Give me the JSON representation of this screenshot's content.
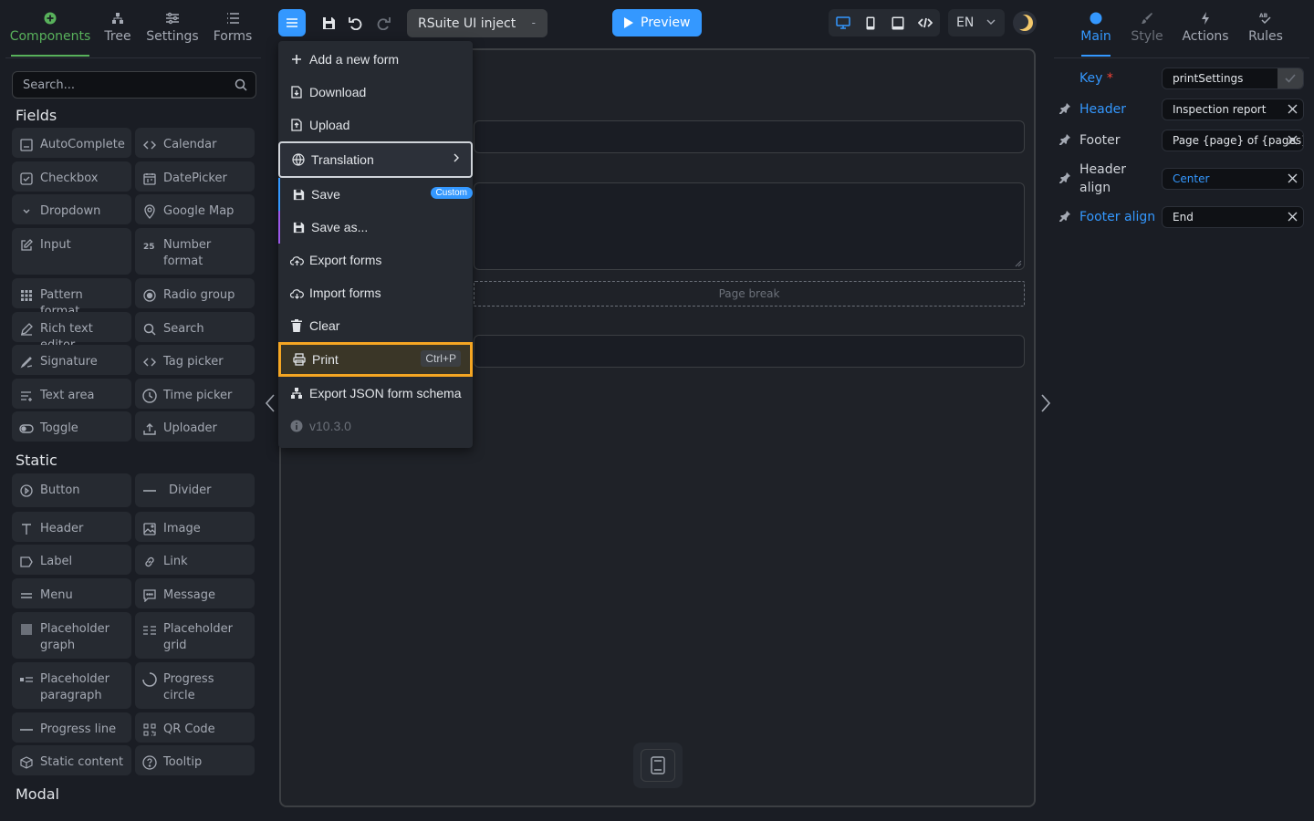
{
  "left_tabs": [
    {
      "label": "Components",
      "icon": "plus-circle-icon",
      "active": true
    },
    {
      "label": "Tree",
      "icon": "tree-icon"
    },
    {
      "label": "Settings",
      "icon": "sliders-icon"
    },
    {
      "label": "Forms",
      "icon": "list-icon"
    }
  ],
  "search": {
    "placeholder": "Search..."
  },
  "sections": {
    "fields": "Fields",
    "static": "Static",
    "modal": "Modal"
  },
  "fields": [
    {
      "label": "AutoComplete",
      "icon": "autocomplete-icon"
    },
    {
      "label": "Calendar",
      "icon": "code-brackets-icon"
    },
    {
      "label": "Checkbox",
      "icon": "checkbox-icon"
    },
    {
      "label": "DatePicker",
      "icon": "calendar-icon"
    },
    {
      "label": "Dropdown",
      "icon": "chevron-down-icon"
    },
    {
      "label": "Google Map",
      "icon": "map-pin-icon"
    },
    {
      "label": "Input",
      "icon": "edit-icon"
    },
    {
      "label": "Number format",
      "icon": "number-icon"
    },
    {
      "label": "Pattern format",
      "icon": "grid-dots-icon"
    },
    {
      "label": "Radio group",
      "icon": "radio-icon"
    },
    {
      "label": "Rich text editor",
      "icon": "pen-icon"
    },
    {
      "label": "Search",
      "icon": "search-icon"
    },
    {
      "label": "Signature",
      "icon": "signature-icon"
    },
    {
      "label": "Tag picker",
      "icon": "code-brackets-icon"
    },
    {
      "label": "Text area",
      "icon": "text-area-icon"
    },
    {
      "label": "Time picker",
      "icon": "clock-icon"
    },
    {
      "label": "Toggle",
      "icon": "toggle-icon"
    },
    {
      "label": "Uploader",
      "icon": "upload-icon"
    }
  ],
  "statics": [
    {
      "label": "Button",
      "icon": "button-icon"
    },
    {
      "label": "Divider",
      "icon": "divider-icon"
    },
    {
      "label": "Header",
      "icon": "text-t-icon"
    },
    {
      "label": "Image",
      "icon": "image-icon"
    },
    {
      "label": "Label",
      "icon": "label-icon"
    },
    {
      "label": "Link",
      "icon": "link-icon"
    },
    {
      "label": "Menu",
      "icon": "menu-icon"
    },
    {
      "label": "Message",
      "icon": "message-icon"
    },
    {
      "label": "Placeholder graph",
      "icon": "square-icon"
    },
    {
      "label": "Placeholder grid",
      "icon": "grid-lines-icon"
    },
    {
      "label": "Placeholder paragraph",
      "icon": "paragraph-icon"
    },
    {
      "label": "Progress circle",
      "icon": "progress-circle-icon"
    },
    {
      "label": "Progress line",
      "icon": "progress-line-icon"
    },
    {
      "label": "QR Code",
      "icon": "qr-code-icon"
    },
    {
      "label": "Static content",
      "icon": "cube-icon"
    },
    {
      "label": "Tooltip",
      "icon": "help-circle-icon"
    }
  ],
  "toolbar": {
    "project_name": "RSuite UI inject",
    "project_caret": "-",
    "preview_label": "Preview",
    "language": "EN"
  },
  "canvas": {
    "page_break_label": "Page break"
  },
  "menu": {
    "add_form": "Add a new form",
    "download": "Download",
    "upload": "Upload",
    "translation": "Translation",
    "save": "Save",
    "save_badge": "Custom",
    "save_as": "Save as...",
    "export_forms": "Export forms",
    "import_forms": "Import forms",
    "clear": "Clear",
    "print": "Print",
    "print_shortcut": "Ctrl+P",
    "export_json": "Export JSON form schema",
    "version": "v10.3.0"
  },
  "right_tabs": [
    {
      "label": "Main",
      "icon": "dot-icon",
      "active": true
    },
    {
      "label": "Style",
      "icon": "brush-icon"
    },
    {
      "label": "Actions",
      "icon": "bolt-icon"
    },
    {
      "label": "Rules",
      "icon": "rules-icon"
    }
  ],
  "props": {
    "key_label": "Key",
    "key_required": "*",
    "key_value": "printSettings",
    "header_label": "Header",
    "header_value": "Inspection report",
    "footer_label": "Footer",
    "footer_value": "Page {page} of {pages}",
    "header_align_label": "Header align",
    "header_align_value": "Center",
    "footer_align_label": "Footer align",
    "footer_align_value": "End"
  },
  "colors": {
    "accent": "#3498ff",
    "components_green": "#58b15b",
    "highlight_orange": "#f5a623"
  }
}
